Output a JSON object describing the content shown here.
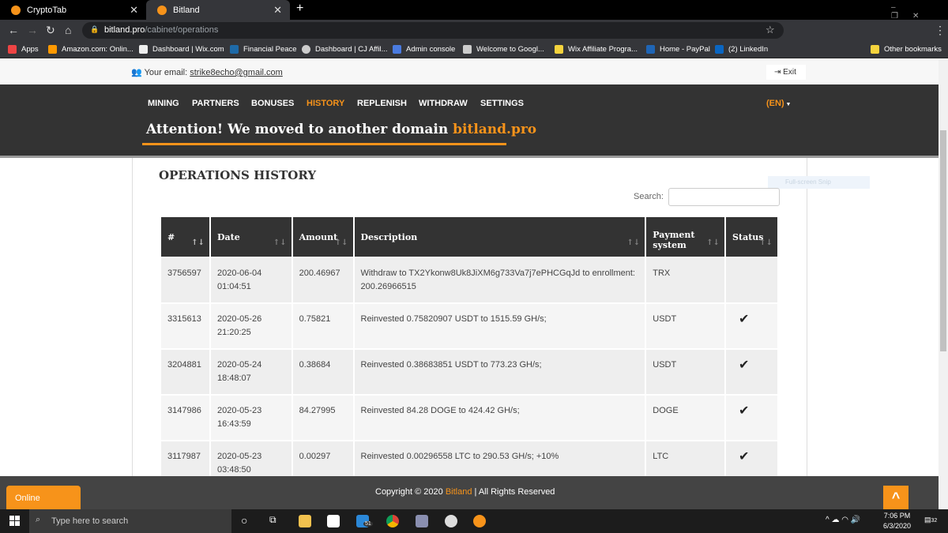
{
  "browser": {
    "tabs": [
      {
        "title": "CryptoTab"
      },
      {
        "title": "Bitland"
      }
    ],
    "url_host": "bitland.pro",
    "url_path": "/cabinet/operations",
    "bookmarks": [
      "Apps",
      "Amazon.com: Onlin...",
      "Dashboard | Wix.com",
      "Financial Peace",
      "Dashboard | CJ Affil...",
      "Admin console",
      "Welcome to Googl...",
      "Wix Affiliate Progra...",
      "Home - PayPal",
      "(2) LinkedIn"
    ],
    "other_bookmarks": "Other bookmarks"
  },
  "header": {
    "email_label": "Your email:",
    "email": "strike8echo@gmail.com",
    "exit": "Exit"
  },
  "nav": {
    "items": [
      "MINING",
      "PARTNERS",
      "BONUSES",
      "HISTORY",
      "REPLENISH",
      "WITHDRAW",
      "SETTINGS"
    ],
    "active": "HISTORY",
    "lang": "(EN)"
  },
  "attention": {
    "text": "Attention! We moved to another domain ",
    "domain": "bitland.pro"
  },
  "page": {
    "title": "OPERATIONS HISTORY",
    "search_label": "Search:",
    "snip": "Full-screen Snip"
  },
  "table": {
    "columns": [
      "#",
      "Date",
      "Amount",
      "Description",
      "Payment system",
      "Status"
    ],
    "rows": [
      {
        "id": "3756597",
        "date": "2020-06-04",
        "time": "01:04:51",
        "amount": "200.46967",
        "desc": "Withdraw to TX2Ykonw8Uk8JiXM6g733Va7j7ePHCGqJd to enrollment: 200.26966515",
        "system": "TRX",
        "status": ""
      },
      {
        "id": "3315613",
        "date": "2020-05-26",
        "time": "21:20:25",
        "amount": "0.75821",
        "desc": "Reinvested 0.75820907 USDT to 1515.59 GH/s;",
        "system": "USDT",
        "status": "✔"
      },
      {
        "id": "3204881",
        "date": "2020-05-24",
        "time": "18:48:07",
        "amount": "0.38684",
        "desc": "Reinvested 0.38683851 USDT to 773.23 GH/s;",
        "system": "USDT",
        "status": "✔"
      },
      {
        "id": "3147986",
        "date": "2020-05-23",
        "time": "16:43:59",
        "amount": "84.27995",
        "desc": "Reinvested 84.28 DOGE to 424.42 GH/s;",
        "system": "DOGE",
        "status": "✔"
      },
      {
        "id": "3117987",
        "date": "2020-05-23",
        "time": "03:48:50",
        "amount": "0.00297",
        "desc": "Reinvested 0.00296558 LTC to 290.53 GH/s; +10%",
        "system": "LTC",
        "status": "✔"
      }
    ]
  },
  "footer": {
    "copy_pre": "Copyright © 2020 ",
    "brand": "Bitland",
    "copy_post": " | All Rights Reserved",
    "online": "Online"
  },
  "taskbar": {
    "search_placeholder": "Type here to search",
    "time": "7:06 PM",
    "date": "6/3/2020",
    "mail_badge": "51",
    "notif_badge": "32"
  },
  "colors": {
    "accent": "#f7931a",
    "dark": "#333333"
  }
}
